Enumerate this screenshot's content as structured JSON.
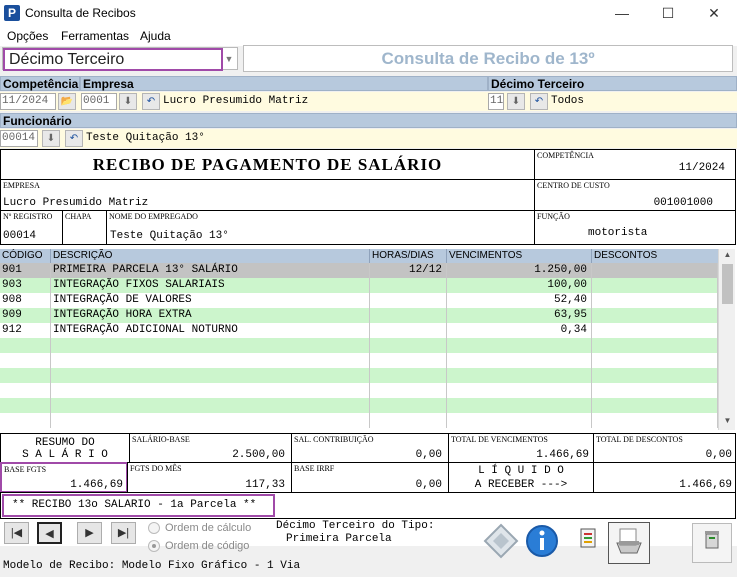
{
  "window": {
    "title": "Consulta de Recibos",
    "minimize": "—",
    "maximize": "☐",
    "close": "✕"
  },
  "menu": [
    "Opções",
    "Ferramentas",
    "Ajuda"
  ],
  "type_combo": {
    "value": "Décimo Terceiro"
  },
  "header": {
    "title": "Consulta de Recibo de 13º"
  },
  "filters": {
    "competencia_label": "Competência",
    "competencia_value": "11/2024",
    "empresa_label": "Empresa",
    "empresa_code": "0001",
    "empresa_name": "Lucro Presumido Matriz",
    "decimo_label": "Décimo Terceiro",
    "decimo_code": "11",
    "decimo_name": "Todos",
    "funcionario_label": "Funcionário",
    "funcionario_code": "00014",
    "funcionario_name": "Teste Quitação 13°"
  },
  "receipt": {
    "title": "RECIBO DE PAGAMENTO DE SALÁRIO",
    "competencia_label": "COMPETÊNCIA",
    "competencia": "11/2024",
    "empresa_label": "EMPRESA",
    "empresa": "Lucro Presumido Matriz",
    "centro_label": "CENTRO DE CUSTO",
    "centro": "001001000",
    "registro_label": "Nº REGISTRO",
    "registro": "00014",
    "chapa_label": "CHAPA",
    "nome_label": "NOME DO EMPREGADO",
    "nome": "Teste Quitação 13°",
    "funcao_label": "FUNÇÃO",
    "funcao": "motorista"
  },
  "grid": {
    "headers": [
      "CÓDIGO",
      "DESCRIÇÃO",
      "HORAS/DIAS",
      "VENCIMENTOS",
      "DESCONTOS"
    ],
    "rows": [
      [
        "901",
        "PRIMEIRA PARCELA 13° SALÁRIO",
        "12/12",
        "1.250,00",
        ""
      ],
      [
        "903",
        "INTEGRAÇÃO FIXOS SALARIAIS",
        "",
        "100,00",
        ""
      ],
      [
        "908",
        "INTEGRAÇÃO DE VALORES",
        "",
        "52,40",
        ""
      ],
      [
        "909",
        "INTEGRAÇÃO HORA EXTRA",
        "",
        "63,95",
        ""
      ],
      [
        "912",
        "INTEGRAÇÃO ADICIONAL NOTURNO",
        "",
        "0,34",
        ""
      ]
    ]
  },
  "summary": {
    "resumo_line1": "RESUMO DO",
    "resumo_line2": "S A L Á R I O",
    "salario_base_label": "SALÁRIO-BASE",
    "salario_base": "2.500,00",
    "sal_contrib_label": "SAL. CONTRIBUIÇÃO",
    "sal_contrib": "0,00",
    "total_venc_label": "TOTAL DE VENCIMENTOS",
    "total_venc": "1.466,69",
    "total_desc_label": "TOTAL DE DESCONTOS",
    "total_desc": "0,00",
    "base_fgts_label": "BASE FGTS",
    "base_fgts": "1.466,69",
    "fgts_mes_label": "FGTS DO MÊS",
    "fgts_mes": "117,33",
    "base_irrf_label": "BASE IRRF",
    "base_irrf": "0,00",
    "liquido_line1": "L Í Q U I D O",
    "liquido_line2": "A RECEBER --->",
    "liquido": "1.466,69"
  },
  "footer_note": "** RECIBO 13o SALARIO - 1a Parcela **",
  "order": {
    "calculo": "Ordem de cálculo",
    "codigo": "Ordem de código",
    "selected": "codigo"
  },
  "tipo": {
    "line1": "Décimo Terceiro do Tipo:",
    "line2": "Primeira Parcela"
  },
  "status": "Modelo de Recibo: Modelo Fixo Gráfico - 1 Via",
  "nav": {
    "first": "|◀",
    "prev": "◀",
    "next": "▶",
    "last": "▶|"
  }
}
